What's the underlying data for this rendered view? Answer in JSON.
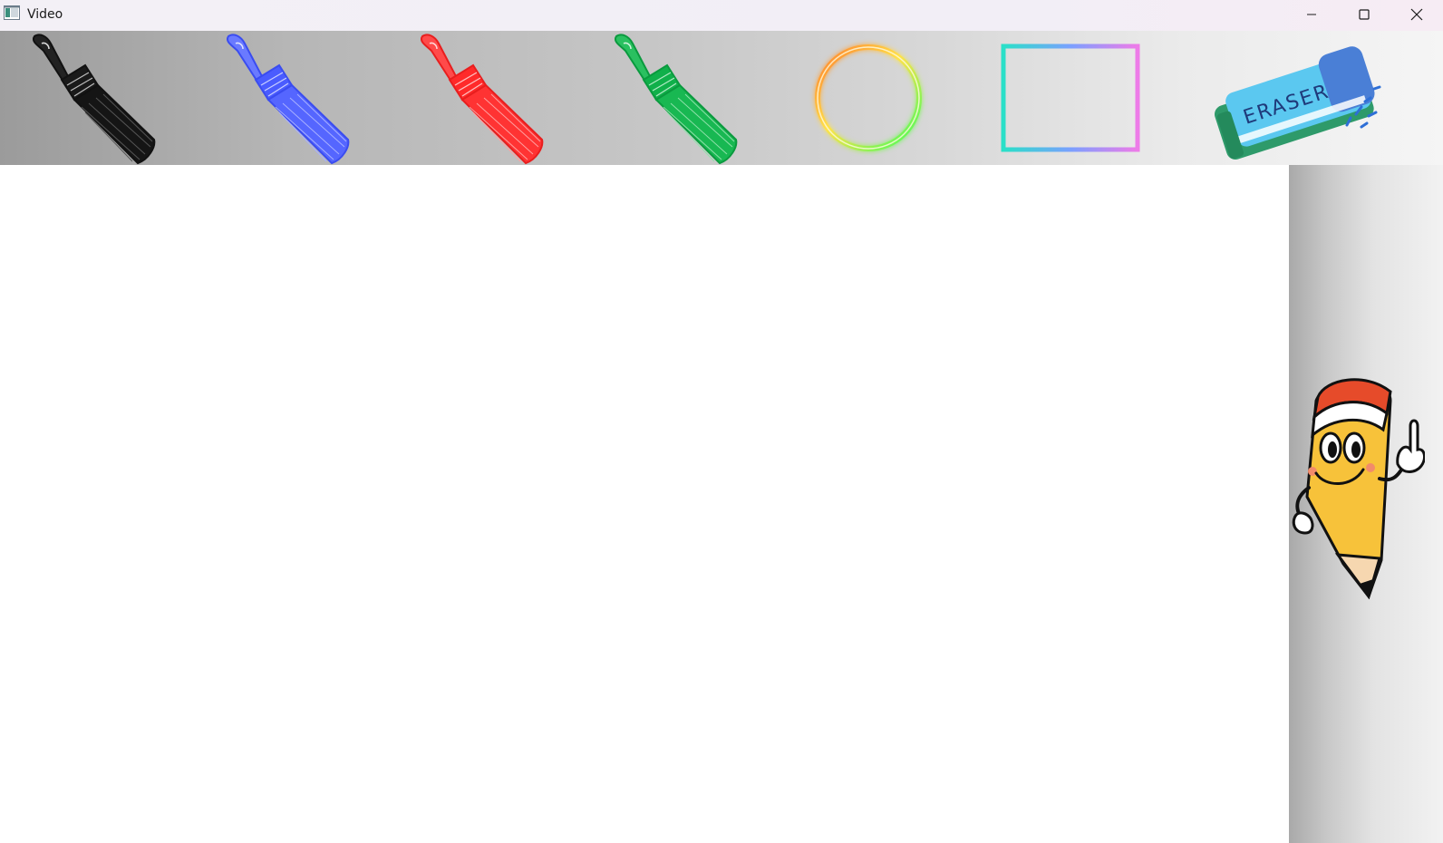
{
  "window": {
    "title": "Video",
    "controls": {
      "minimize": "minimize",
      "maximize": "maximize",
      "close": "close"
    }
  },
  "toolbar": {
    "tools": [
      {
        "id": "brush-black",
        "icon": "paint-brush-icon",
        "color": "#111111"
      },
      {
        "id": "brush-blue",
        "icon": "paint-brush-icon",
        "color": "#4a5cff"
      },
      {
        "id": "brush-red",
        "icon": "paint-brush-icon",
        "color": "#ff2a2a"
      },
      {
        "id": "brush-green",
        "icon": "paint-brush-icon",
        "color": "#10b04a"
      },
      {
        "id": "circle-tool",
        "icon": "circle-shape-icon",
        "colors": [
          "#ff7a2a",
          "#ffe24a",
          "#3cff5a"
        ]
      },
      {
        "id": "rectangle-tool",
        "icon": "rectangle-shape-icon",
        "colors": [
          "#29e0c8",
          "#7aa0ff",
          "#ee7be8"
        ]
      },
      {
        "id": "eraser-tool",
        "icon": "eraser-icon",
        "label": "ERASER",
        "colors": [
          "#5bc8f0",
          "#4a7fd6",
          "#2e9a6a"
        ]
      }
    ]
  },
  "side_panel": {
    "mascot": "pencil-mascot-icon"
  }
}
